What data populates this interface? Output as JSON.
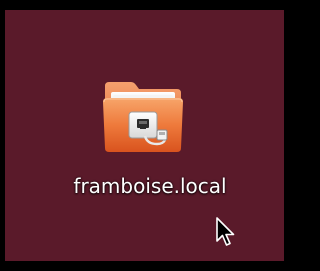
{
  "desktop": {
    "background_color": "#5a1a2a",
    "icons": [
      {
        "label": "framboise.local",
        "icon": "network-share-folder-icon"
      }
    ]
  },
  "cursor": {
    "icon": "mouse-pointer-icon"
  }
}
